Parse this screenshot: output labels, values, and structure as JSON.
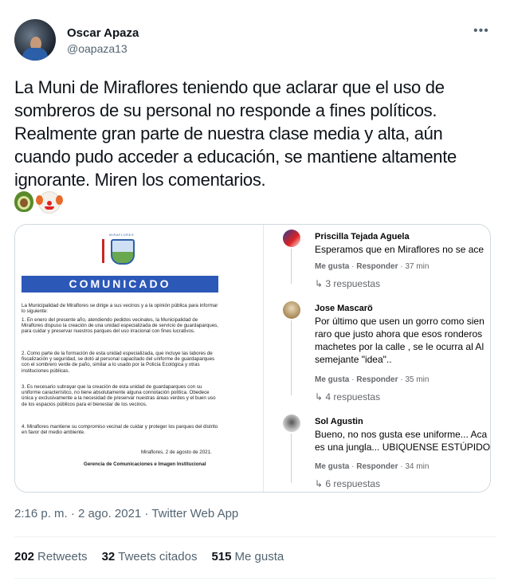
{
  "tweet": {
    "author_name": "Oscar Apaza",
    "author_handle": "@oapaza13",
    "more_label": "•••",
    "text": "La Muni de Miraflores teniendo que aclarar que el uso de sombreros de su personal no responde a fines políticos. Realmente gran parte de nuestra clase media y alta, aún cuando pudo acceder a educación, se mantiene altamente ignorante. Miren los comentarios.",
    "emojis": [
      "avocado-emoji",
      "clown-face-emoji"
    ],
    "timestamp": "2:16 p. m. · 2 ago. 2021 · Twitter Web App",
    "stats": {
      "retweets_count": "202",
      "retweets_label": "Retweets",
      "quotes_count": "32",
      "quotes_label": "Tweets citados",
      "likes_count": "515",
      "likes_label": "Me gusta"
    }
  },
  "document": {
    "logo_text": "MIRAFLORES",
    "banner": "COMUNICADO",
    "intro": "La Municipalidad de Miraflores se dirige a sus vecinos y a la opinión pública para informar lo siguiente:",
    "items": [
      "1.  En enero del presente año, atendiendo pedidos vecinales, la Municipalidad de Miraflores dispuso la creación de una unidad especializada de servicio de guardaparques, para cuidar y preservar nuestros parques del uso irracional con fines lucrativos.",
      "2.  Como parte de la formación de esta unidad especializada, que incluye las labores de fiscalización y seguridad, se dotó al personal capacitado del uniforme de guardaparques con el sombrero verde de paño, similar a lo usado por la Policía Ecológica y otras instituciones públicas.",
      "3.  Es necesario subrayar que la creación de esta unidad de guardaparques con su uniforme característico, no tiene absolutamente alguna connotación política. Obedece única y exclusivamente a la necesidad de preservar nuestras áreas verdes y el buen uso de los espacios públicos para el bienestar de los vecinos.",
      "4.  Miraflores mantiene su compromiso vecinal de cuidar y proteger los parques del distrito en favor del medio ambiente."
    ],
    "place_date": "Miraflores, 2 de agosto de 2021.",
    "signature": "Gerencia de Comunicaciones e Imagen Institucional"
  },
  "comments": [
    {
      "name": "Priscilla Tejada Aguela",
      "lines": [
        "Esperamos que en Miraflores no se ace"
      ],
      "like": "Me gusta",
      "reply": "Responder",
      "time": "37 min",
      "replies": "3 respuestas"
    },
    {
      "name": "Jose Mascarö",
      "lines": [
        "Por último que usen un gorro como sien",
        "raro que justo ahora que esos ronderos",
        "machetes por la calle , se le ocurra al Al",
        "semejante \"idea\".."
      ],
      "like": "Me gusta",
      "reply": "Responder",
      "time": "35 min",
      "replies": "4 respuestas"
    },
    {
      "name": "Sol Agustin",
      "lines": [
        "Bueno, no nos gusta ese uniforme... Aca",
        "es una jungla... UBIQUENSE ESTÚPIDOS"
      ],
      "like": "Me gusta",
      "reply": "Responder",
      "time": "34 min",
      "replies": "6 respuestas"
    }
  ]
}
